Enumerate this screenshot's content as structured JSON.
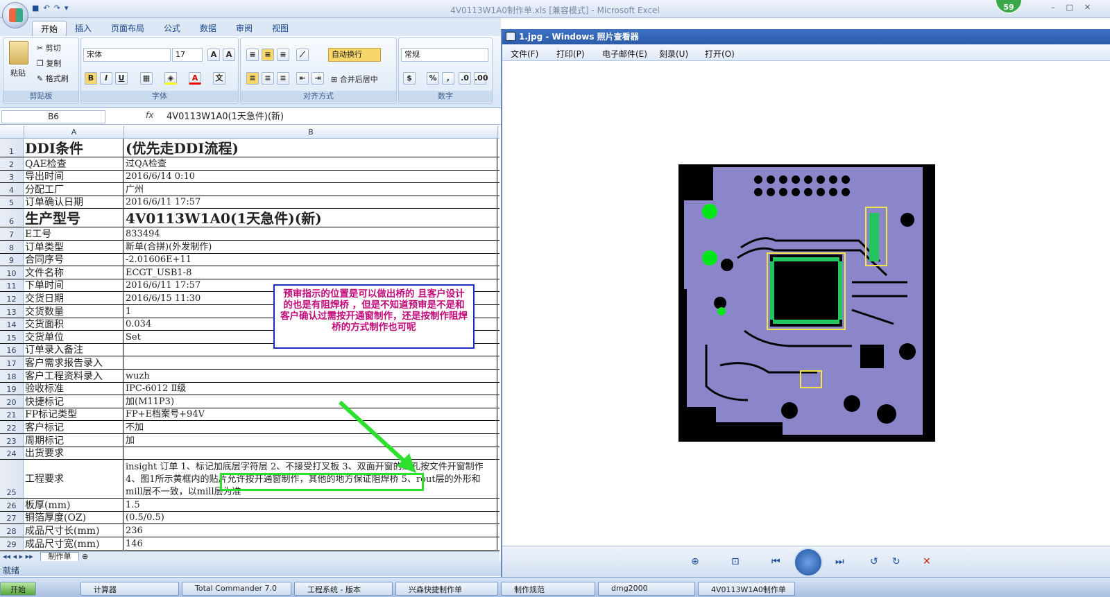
{
  "excel": {
    "title": "4V0113W1A0制作单.xls  [兼容模式] - Microsoft Excel",
    "badge": "59",
    "tabs": [
      "开始",
      "插入",
      "页面布局",
      "公式",
      "数据",
      "审阅",
      "视图"
    ],
    "ribbon": {
      "paste": "粘贴",
      "cut": "剪切",
      "copy": "复制",
      "format_painter": "格式刷",
      "clipboard": "剪贴板",
      "font_name": "宋体",
      "font_size": "17",
      "font": "字体",
      "wrap": "自动换行",
      "merge": "合并后居中",
      "align": "对齐方式",
      "number_format": "常规",
      "number": "数字",
      "bold": "B",
      "italic": "I",
      "underline": "U",
      "percent": "%",
      "comma": ","
    },
    "name_box": "B6",
    "fx": "fx",
    "formula": "4V0113W1A0(1天急件)(新)",
    "columns": [
      "A",
      "B"
    ],
    "rows": [
      {
        "n": "1",
        "a": "DDI条件",
        "b": "(优先走DDI流程)"
      },
      {
        "n": "2",
        "a": "QAE检查",
        "b": "过QA检查"
      },
      {
        "n": "3",
        "a": "导出时间",
        "b": "2016/6/14 0:10"
      },
      {
        "n": "4",
        "a": "分配工厂",
        "b": "广州"
      },
      {
        "n": "5",
        "a": "订单确认日期",
        "b": "2016/6/11 17:57"
      },
      {
        "n": "6",
        "a": "生产型号",
        "b": "4V0113W1A0(1天急件)(新)"
      },
      {
        "n": "7",
        "a": "E工号",
        "b": "833494"
      },
      {
        "n": "8",
        "a": "订单类型",
        "b": "新单(合拼)(外发制作)"
      },
      {
        "n": "9",
        "a": "合同序号",
        "b": "-2.01606E+11"
      },
      {
        "n": "10",
        "a": "文件名称",
        "b": "ECGT_USB1-8"
      },
      {
        "n": "11",
        "a": "下单时间",
        "b": "2016/6/11 17:57"
      },
      {
        "n": "12",
        "a": "交货日期",
        "b": "2016/6/15 11:30"
      },
      {
        "n": "13",
        "a": "交货数量",
        "b": "1"
      },
      {
        "n": "14",
        "a": "交货面积",
        "b": "0.034"
      },
      {
        "n": "15",
        "a": "交货单位",
        "b": "Set"
      },
      {
        "n": "16",
        "a": "订单录入备注",
        "b": ""
      },
      {
        "n": "17",
        "a": "客户需求报告录入",
        "b": ""
      },
      {
        "n": "18",
        "a": "客户工程资料录入",
        "b": "wuzh"
      },
      {
        "n": "19",
        "a": "验收标准",
        "b": "IPC-6012 Ⅱ级"
      },
      {
        "n": "20",
        "a": "快捷标记",
        "b": "加(M11P3)"
      },
      {
        "n": "21",
        "a": "FP标记类型",
        "b": "FP+E档案号+94V"
      },
      {
        "n": "22",
        "a": "客户标记",
        "b": "不加"
      },
      {
        "n": "23",
        "a": "周期标记",
        "b": "加"
      },
      {
        "n": "24",
        "a": "出货要求",
        "b": ""
      },
      {
        "n": "25",
        "a": "工程要求",
        "b": "insight 订单 1、标记加底层字符层  2、不接受打叉板  3、双面开窗的过孔按文件开窗制作  4、图1所示黄框内的贴片允许按开通窗制作，其他的地方保证阻焊桥  5、rout层的外形和mill层不一致，以mill层为准"
      },
      {
        "n": "26",
        "a": "板厚(mm)",
        "b": "1.5"
      },
      {
        "n": "27",
        "a": "铜箔厚度(OZ)",
        "b": " (0.5/0.5)"
      },
      {
        "n": "28",
        "a": "成品尺寸长(mm)",
        "b": "236"
      },
      {
        "n": "29",
        "a": "成品尺寸宽(mm)",
        "b": "146"
      }
    ],
    "sheet_tab": "制作单",
    "status": "就绪",
    "note": "预审指示的位置是可以做出桥的  且客户设计的也是有阻焊桥  ，但是不知道预审是不是和客户确认过需按开通窗制作，还是按制作阻焊桥的方式制作也可呢"
  },
  "viewer": {
    "title": "1.jpg - Windows 照片查看器",
    "menu": [
      "文件(F)",
      "打印(P)",
      "电子邮件(E)",
      "刻录(U)",
      "打开(O)"
    ]
  },
  "taskbar": [
    "开始",
    "计算器",
    "Total Commander 7.0",
    "工程系统 - 版本",
    "兴森快捷制作单",
    "制作规范",
    "dmg2000",
    "4V0113W1A0制作单"
  ],
  "colors": {
    "accent": "#1b2fc2",
    "note_text": "#c00a7a",
    "highlight": "#2ee02e",
    "pcb_fill": "#8a86c9"
  }
}
